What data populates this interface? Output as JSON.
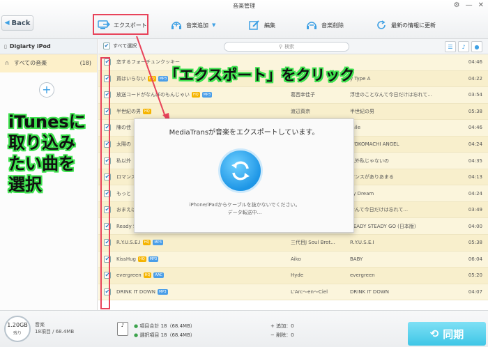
{
  "window": {
    "title": "音楽管理"
  },
  "toolbar": {
    "back_label": "Back",
    "export_label": "エクスポート",
    "add_music_label": "音楽追加",
    "edit_label": "編集",
    "delete_label": "音楽削除",
    "refresh_label": "最新の情報に更新"
  },
  "sidebar": {
    "device_name": "Digiarty iPod",
    "all_music_label": "すべての音楽",
    "all_music_count": "(18)"
  },
  "list": {
    "select_all_label": "すべて選択",
    "search_placeholder": "検索"
  },
  "rows": [
    {
      "title": "恋するフォーチュンクッキー",
      "badges": [],
      "artist": "",
      "album": "",
      "time": "04:46"
    },
    {
      "title": "買はいらない",
      "badges": [
        "HQ",
        "MP3"
      ],
      "artist": "",
      "album": "y Type A",
      "time": "04:22"
    },
    {
      "title": "放送コードがなんぼのもんじゃい",
      "badges": [
        "HQ",
        "MP3"
      ],
      "artist": "葛西幸佳子",
      "album": "浮世のことなんて今日だけは忘れて...",
      "time": "03:54"
    },
    {
      "title": "半世紀の男",
      "badges": [
        "HQ"
      ],
      "artist": "渡辺真奈",
      "album": "半世紀の男",
      "time": "05:38"
    },
    {
      "title": "陳の佳",
      "badges": [],
      "artist": "",
      "album": "mile",
      "time": "04:46"
    },
    {
      "title": "太陽の",
      "badges": [],
      "artist": "",
      "album": "ITOKOMACHI ANGEL",
      "time": "04:24"
    },
    {
      "title": "私以外",
      "badges": [],
      "artist": "",
      "album": "以外私じゃないの",
      "time": "04:35"
    },
    {
      "title": "ロマンス",
      "badges": [],
      "artist": "",
      "album": "マンスがありあまる",
      "time": "04:13"
    },
    {
      "title": "もっと",
      "badges": [],
      "artist": "",
      "album": "ay Dream",
      "time": "04:24"
    },
    {
      "title": "おまえは",
      "badges": [],
      "artist": "",
      "album": "なんて今日だけは忘れて...",
      "time": "03:49"
    },
    {
      "title": "Ready Steady Go (kenless version)",
      "badges": [
        "MP3"
      ],
      "artist": "L'Arc〜en〜Ciel",
      "album": "READY STEADY GO (日本版)",
      "time": "04:00"
    },
    {
      "title": "R.Y.U.S.E.I",
      "badges": [
        "HQ",
        "MP3"
      ],
      "artist": "三代目J Soul Brot...",
      "album": "R.Y.U.S.E.I",
      "time": "05:38"
    },
    {
      "title": "KissHug",
      "badges": [
        "HQ",
        "MP3"
      ],
      "artist": "Aiko",
      "album": "BABY",
      "time": "06:04"
    },
    {
      "title": "evergreen",
      "badges": [
        "HQ",
        "AAC"
      ],
      "artist": "Hyde",
      "album": "evergreen",
      "time": "05:20"
    },
    {
      "title": "DRINK IT DOWN",
      "badges": [
        "MP3"
      ],
      "artist": "L'Arc〜en〜Ciel",
      "album": "DRINK IT DOWN",
      "time": "04:07"
    }
  ],
  "modal": {
    "title": "MediaTransが音楽をエクスポートしています。",
    "note_line1": "iPhone/iPadからケーブルを抜かないでください。",
    "note_line2": "データ転送中..."
  },
  "annotations": {
    "click_text": "「エクスポート」をクリック",
    "select_line1": "iTunesに",
    "select_line2": "取り込み",
    "select_line3": "たい曲を",
    "select_line4": "選択",
    "highlight_color": "#e8435a",
    "text_outline_color": "#3ee24e"
  },
  "footer": {
    "storage_size": "1.20GB",
    "storage_label": "残り",
    "device_label": "音楽",
    "device_summary": "18項目 / 68.4MB",
    "total_items": "項目合計 18（68.4MB）",
    "selected_items": "選択項目 18（68.4MB）",
    "add_count": "+ 追加：0",
    "delete_count": "− 削除：0",
    "sync_label": "同期"
  }
}
